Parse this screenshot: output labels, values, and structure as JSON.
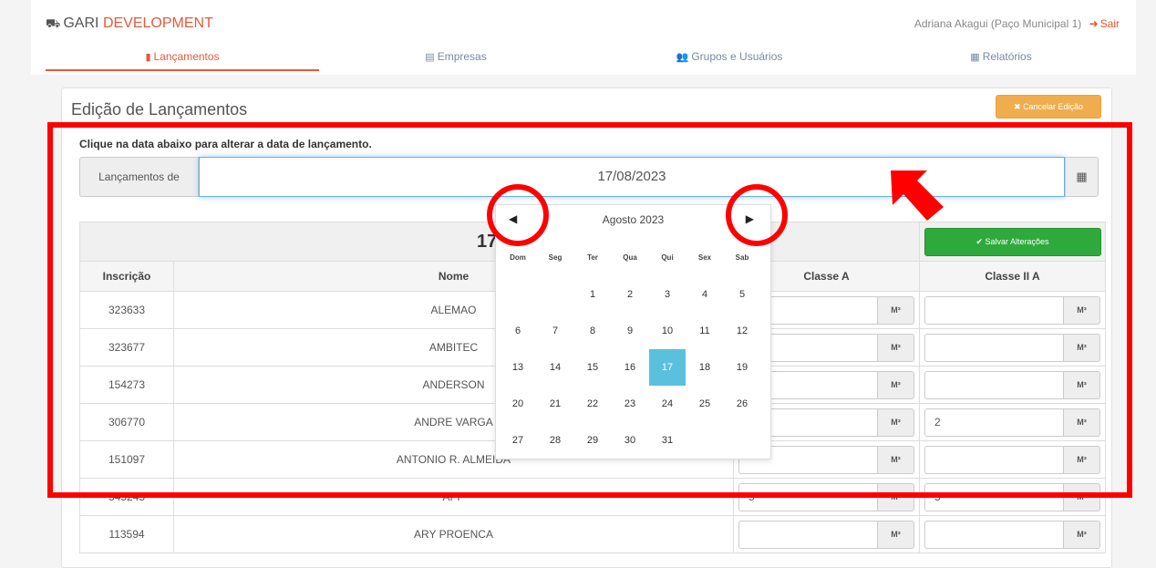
{
  "brand": {
    "prefix": "GARI",
    "accent": "DEVELOPMENT",
    "icon": "truck-icon"
  },
  "user": {
    "name": "Adriana Akagui (Paço Municipal 1)",
    "logout_label": "Sair",
    "logout_icon": "sign-out-icon"
  },
  "nav": {
    "tabs": [
      {
        "label": "Lançamentos",
        "icon": "book-icon",
        "active": true
      },
      {
        "label": "Empresas",
        "icon": "list-icon",
        "active": false
      },
      {
        "label": "Grupos e Usuários",
        "icon": "users-icon",
        "active": false
      },
      {
        "label": "Relatórios",
        "icon": "report-icon",
        "active": false
      }
    ]
  },
  "panel": {
    "title": "Edição de Lançamentos",
    "cancel_label": "✖ Cancelar Edição"
  },
  "date_picker": {
    "hint": "Clique na data abaixo para alterar a data de lançamento.",
    "addon_label": "Lançamentos de",
    "value": "17/08/2023"
  },
  "calendar": {
    "month_label": "Agosto 2023",
    "prev": "◀",
    "next": "▶",
    "weekdays": [
      "Dom",
      "Seg",
      "Ter",
      "Qua",
      "Qui",
      "Sex",
      "Sab"
    ],
    "first_weekday_index": 2,
    "days_in_month": 31,
    "selected_day": 17
  },
  "table": {
    "date_header": "17/08",
    "save_label": "✔ Salvar Alterações",
    "columns": {
      "inscricao": "Inscrição",
      "nome": "Nome",
      "classe_a": "Classe A",
      "classe_ii_a": "Classe II A"
    },
    "unit": "M³",
    "rows": [
      {
        "inscricao": "323633",
        "nome": "ALEMAO",
        "classe_a": "",
        "classe_ii_a": ""
      },
      {
        "inscricao": "323677",
        "nome": "AMBITEC",
        "classe_a": "",
        "classe_ii_a": ""
      },
      {
        "inscricao": "154273",
        "nome": "ANDERSON",
        "classe_a": "",
        "classe_ii_a": ""
      },
      {
        "inscricao": "306770",
        "nome": "ANDRE VARGA",
        "classe_a": "",
        "classe_ii_a": "2"
      },
      {
        "inscricao": "151097",
        "nome": "ANTONIO R. ALMEIDA",
        "classe_a": "",
        "classe_ii_a": ""
      },
      {
        "inscricao": "345245",
        "nome": "APP",
        "classe_a": "5",
        "classe_ii_a": "5"
      },
      {
        "inscricao": "113594",
        "nome": "ARY PROENCA",
        "classe_a": "",
        "classe_ii_a": ""
      }
    ]
  },
  "colors": {
    "accent": "#e35a3b",
    "warning": "#f0ad4e",
    "success": "#2eaa3c",
    "selected_day": "#5bc0de",
    "annotation": "#ff0000"
  }
}
